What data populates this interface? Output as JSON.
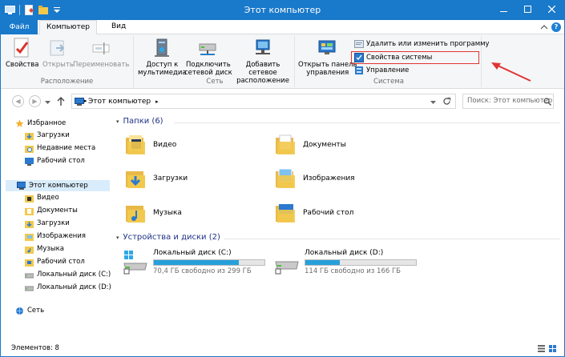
{
  "window": {
    "title": "Этот компьютер"
  },
  "ribbon_tabs": {
    "file": "Файл",
    "computer": "Компьютер",
    "view": "Вид"
  },
  "ribbon": {
    "location": {
      "label": "Расположение",
      "properties": "Свойства",
      "open": "Открыть",
      "rename": "Переименовать"
    },
    "network": {
      "label": "Сеть",
      "media_l1": "Доступ к",
      "media_l2": "мультимедиа",
      "map_l1": "Подключить",
      "map_l2": "сетевой диск",
      "add_l1": "Добавить сетевое",
      "add_l2": "расположение"
    },
    "system": {
      "label": "Система",
      "cp_l1": "Открыть панель",
      "cp_l2": "управления",
      "uninstall": "Удалить или изменить программу",
      "sysprops": "Свойства системы",
      "manage": "Управление"
    }
  },
  "address": {
    "path": "Этот компьютер",
    "search_placeholder": "Поиск: Этот компьютер"
  },
  "nav": {
    "favorites": "Избранное",
    "downloads": "Загрузки",
    "recent": "Недавние места",
    "desktop": "Рабочий стол",
    "this_pc": "Этот компьютер",
    "video": "Видео",
    "documents": "Документы",
    "downloads2": "Загрузки",
    "pictures": "Изображения",
    "music": "Музыка",
    "desktop2": "Рабочий стол",
    "disk_c": "Локальный диск (C:)",
    "disk_d": "Локальный диск (D:)",
    "network": "Сеть"
  },
  "folders": {
    "header": "Папки (6)",
    "items": [
      "Видео",
      "Документы",
      "Загрузки",
      "Изображения",
      "Музыка",
      "Рабочий стол"
    ]
  },
  "devices": {
    "header": "Устройства и диски (2)",
    "drives": [
      {
        "name": "Локальный диск (C:)",
        "free": "70,4 ГБ свободно из 299 ГБ",
        "used_fraction": 0.765
      },
      {
        "name": "Локальный диск (D:)",
        "free": "114 ГБ свободно из 166 ГБ",
        "used_fraction": 0.313
      }
    ]
  },
  "status": {
    "items": "Элементов: 8"
  },
  "colors": {
    "accent": "#1979ca",
    "highlight": "#e03535",
    "bar_fill": "#26a0da"
  }
}
